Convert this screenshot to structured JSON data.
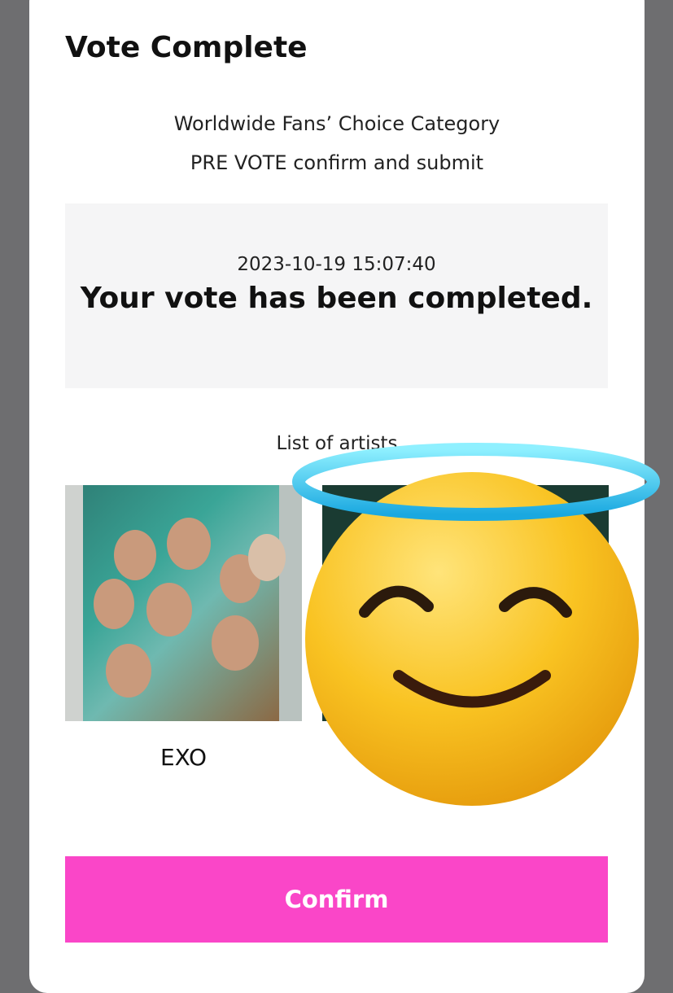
{
  "modal": {
    "title": "Vote Complete",
    "subtitle_line1": "Worldwide Fans’ Choice Category",
    "subtitle_line2": "PRE VOTE confirm and submit"
  },
  "result": {
    "timestamp": "2023-10-19 15:07:40",
    "message": "Your vote has been completed."
  },
  "artists": {
    "list_label": "List of artists",
    "items": [
      {
        "name": "EXO"
      }
    ]
  },
  "footer": {
    "confirm_label": "Confirm"
  },
  "overlay": {
    "sticker": "smiling-face-with-halo-emoji"
  },
  "colors": {
    "accent": "#fa46c8",
    "box_bg": "#f5f5f6",
    "backdrop": "#6e6e70"
  }
}
